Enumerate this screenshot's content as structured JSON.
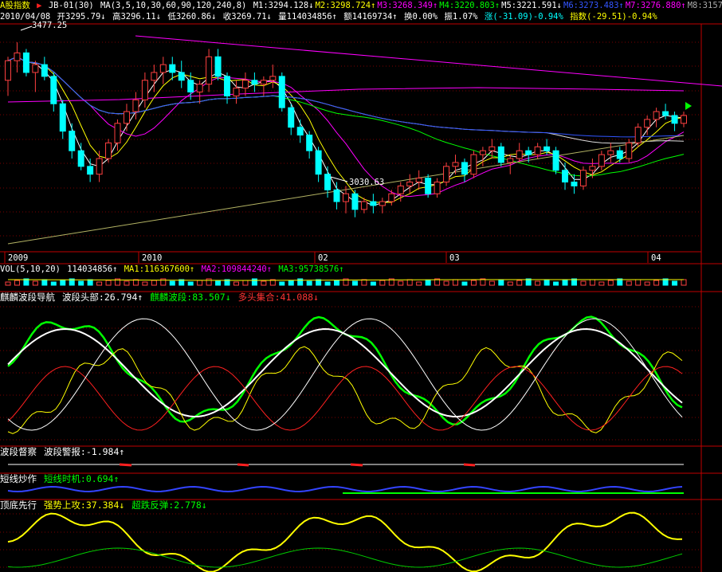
{
  "header": {
    "index_name": "A股指数",
    "template": "JB-01(30)",
    "ma_label": "MA(3,5,10,30,60,90,120,240,8)",
    "ma_values": [
      {
        "label": "M1:3294.128↓",
        "color": "#ffffff"
      },
      {
        "label": "M2:3298.724↑",
        "color": "#ffff00"
      },
      {
        "label": "M3:3268.349↑",
        "color": "#ff00ff"
      },
      {
        "label": "M4:3220.803↑",
        "color": "#00ff00"
      },
      {
        "label": "M5:3221.591↓",
        "color": "#ffffff"
      },
      {
        "label": "M6:3273.483↑",
        "color": "#3355ff"
      },
      {
        "label": "M7:3276.880↑",
        "color": "#ff00ff"
      },
      {
        "label": "M8:3157",
        "color": "#aaaaaa"
      }
    ],
    "date": "2010/04/08",
    "open": "开3295.79↓",
    "high": "高3296.11↓",
    "low": "低3260.86↓",
    "close": "收3269.71↓",
    "volume": "量114034856↑",
    "amount": "额14169734↑",
    "turnover": "换0.00%",
    "amplitude": "振1.07%",
    "change": "涨(-31.09)-0.94%",
    "index_change": "指数(-29.51)-0.94%"
  },
  "price_labels": {
    "high": "3477.25",
    "low": "3030.63"
  },
  "x_axis_labels": [
    "2009",
    "2010",
    "02",
    "03",
    "04"
  ],
  "volume_panel": {
    "label": "VOL(5,10,20)",
    "value": "114034856↑",
    "ma1": "MA1:116367600↑",
    "ma2": "MA2:109844240↑",
    "ma3": "MA3:95738576↑"
  },
  "panel_wave": {
    "title": "麒麟波段导航",
    "v1": "波段头部:26.794↑",
    "v2": "麒麟波段:83.507↓",
    "v3": "多头集合:41.088↓"
  },
  "panel_watch": {
    "title": "波段督察",
    "v1": "波段警报:-1.984↑"
  },
  "panel_short": {
    "title": "短线炒作",
    "v1": "短线时机:0.694↑"
  },
  "panel_top": {
    "title": "顶底先行",
    "v1": "强势上攻:37.384↓",
    "v2": "超跌反弹:2.778↓"
  },
  "chart_data": {
    "type": "candlestick",
    "ylim": [
      2950,
      3520
    ],
    "candles": [
      [
        3380,
        3440,
        3340,
        3430
      ],
      [
        3430,
        3477,
        3400,
        3450
      ],
      [
        3450,
        3460,
        3390,
        3400
      ],
      [
        3400,
        3430,
        3350,
        3420
      ],
      [
        3420,
        3440,
        3380,
        3390
      ],
      [
        3390,
        3400,
        3300,
        3320
      ],
      [
        3320,
        3330,
        3230,
        3250
      ],
      [
        3250,
        3270,
        3180,
        3200
      ],
      [
        3200,
        3220,
        3150,
        3160
      ],
      [
        3160,
        3180,
        3120,
        3140
      ],
      [
        3140,
        3200,
        3120,
        3180
      ],
      [
        3180,
        3230,
        3170,
        3220
      ],
      [
        3220,
        3280,
        3200,
        3270
      ],
      [
        3270,
        3320,
        3250,
        3300
      ],
      [
        3300,
        3350,
        3280,
        3330
      ],
      [
        3330,
        3400,
        3310,
        3380
      ],
      [
        3380,
        3420,
        3350,
        3400
      ],
      [
        3400,
        3440,
        3370,
        3420
      ],
      [
        3420,
        3440,
        3380,
        3400
      ],
      [
        3400,
        3430,
        3360,
        3380
      ],
      [
        3380,
        3400,
        3330,
        3350
      ],
      [
        3350,
        3380,
        3320,
        3370
      ],
      [
        3370,
        3460,
        3350,
        3440
      ],
      [
        3440,
        3460,
        3380,
        3390
      ],
      [
        3390,
        3400,
        3320,
        3340
      ],
      [
        3340,
        3380,
        3320,
        3360
      ],
      [
        3360,
        3400,
        3340,
        3380
      ],
      [
        3380,
        3400,
        3350,
        3370
      ],
      [
        3370,
        3390,
        3340,
        3380
      ],
      [
        3380,
        3420,
        3360,
        3390
      ],
      [
        3390,
        3400,
        3300,
        3310
      ],
      [
        3310,
        3320,
        3240,
        3260
      ],
      [
        3260,
        3280,
        3220,
        3240
      ],
      [
        3240,
        3250,
        3180,
        3200
      ],
      [
        3200,
        3210,
        3120,
        3140
      ],
      [
        3140,
        3160,
        3080,
        3100
      ],
      [
        3100,
        3120,
        3050,
        3070
      ],
      [
        3070,
        3110,
        3040,
        3090
      ],
      [
        3090,
        3100,
        3030,
        3050
      ],
      [
        3050,
        3080,
        3040,
        3070
      ],
      [
        3070,
        3090,
        3040,
        3060
      ],
      [
        3060,
        3080,
        3040,
        3070
      ],
      [
        3070,
        3100,
        3060,
        3090
      ],
      [
        3090,
        3120,
        3070,
        3110
      ],
      [
        3110,
        3140,
        3090,
        3120
      ],
      [
        3120,
        3150,
        3100,
        3130
      ],
      [
        3130,
        3140,
        3080,
        3090
      ],
      [
        3090,
        3130,
        3080,
        3120
      ],
      [
        3120,
        3170,
        3110,
        3160
      ],
      [
        3160,
        3190,
        3140,
        3170
      ],
      [
        3170,
        3180,
        3120,
        3140
      ],
      [
        3140,
        3200,
        3130,
        3190
      ],
      [
        3190,
        3210,
        3160,
        3200
      ],
      [
        3200,
        3230,
        3180,
        3210
      ],
      [
        3210,
        3220,
        3160,
        3170
      ],
      [
        3170,
        3190,
        3140,
        3180
      ],
      [
        3180,
        3220,
        3170,
        3200
      ],
      [
        3200,
        3210,
        3170,
        3190
      ],
      [
        3190,
        3220,
        3180,
        3210
      ],
      [
        3210,
        3230,
        3190,
        3200
      ],
      [
        3200,
        3210,
        3140,
        3150
      ],
      [
        3150,
        3170,
        3100,
        3120
      ],
      [
        3120,
        3140,
        3090,
        3110
      ],
      [
        3110,
        3160,
        3100,
        3150
      ],
      [
        3150,
        3180,
        3130,
        3160
      ],
      [
        3160,
        3200,
        3150,
        3190
      ],
      [
        3190,
        3220,
        3170,
        3200
      ],
      [
        3200,
        3210,
        3170,
        3180
      ],
      [
        3180,
        3230,
        3170,
        3220
      ],
      [
        3220,
        3270,
        3210,
        3260
      ],
      [
        3260,
        3290,
        3240,
        3280
      ],
      [
        3280,
        3310,
        3260,
        3300
      ],
      [
        3300,
        3320,
        3280,
        3290
      ],
      [
        3290,
        3300,
        3250,
        3270
      ],
      [
        3270,
        3300,
        3260,
        3290
      ]
    ]
  }
}
